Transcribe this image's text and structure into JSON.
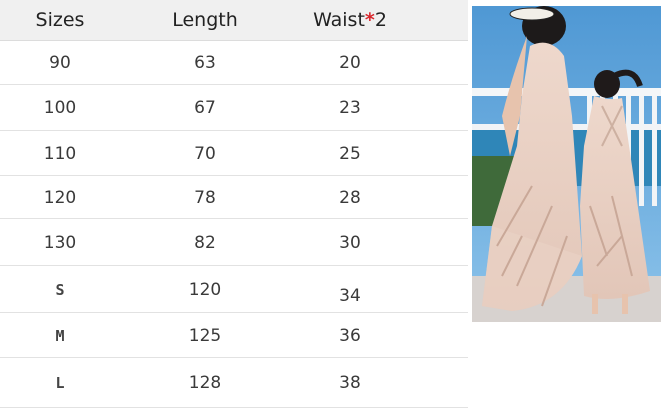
{
  "table": {
    "headers": {
      "sizes": "Sizes",
      "length": "Length",
      "waist": "Waist",
      "asterisk": "*",
      "multiplier": "2"
    },
    "rows": [
      {
        "size": "90",
        "length": "63",
        "waist": "20"
      },
      {
        "size": "100",
        "length": "67",
        "waist": "23"
      },
      {
        "size": "110",
        "length": "70",
        "waist": "25"
      },
      {
        "size": "120",
        "length": "78",
        "waist": "28"
      },
      {
        "size": "130",
        "length": "82",
        "waist": "30"
      },
      {
        "size": "S",
        "length": "120",
        "waist": "34"
      },
      {
        "size": "M",
        "length": "125",
        "waist": "36"
      },
      {
        "size": "L",
        "length": "128",
        "waist": "38"
      }
    ]
  },
  "colors": {
    "header_bg": "#f0f0f0",
    "asterisk": "#d9262c",
    "divider": "#e2e2e2"
  }
}
